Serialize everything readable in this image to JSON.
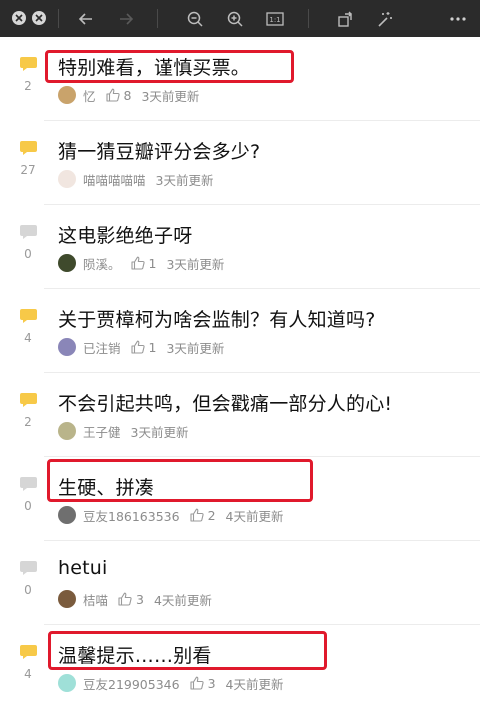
{
  "toolbar": {
    "icons": [
      "close-dot",
      "minimize-dot",
      "back-arrow-icon",
      "forward-arrow-icon",
      "zoom-out-icon",
      "zoom-in-icon",
      "actual-size-icon",
      "rotate-icon",
      "magic-wand-icon",
      "more-icon"
    ],
    "actual_size_label": "1:1"
  },
  "colors": {
    "bubble_active": "#f7c948",
    "bubble_inactive": "#d6d6d6",
    "highlight": "#e0192c"
  },
  "discussions": [
    {
      "title": "特别难看，谨慎买票。",
      "count": "2",
      "active": true,
      "author": "忆",
      "likes": "8",
      "time": "3天前更新",
      "highlighted": true
    },
    {
      "title": "猜一猜豆瓣评分会多少?",
      "count": "27",
      "active": true,
      "author": "喵喵喵喵喵",
      "likes": "",
      "time": "3天前更新",
      "highlighted": false
    },
    {
      "title": "这电影绝绝子呀",
      "count": "0",
      "active": false,
      "author": "陨溪。",
      "likes": "1",
      "time": "3天前更新",
      "highlighted": false
    },
    {
      "title": "关于贾樟柯为啥会监制？有人知道吗?",
      "count": "4",
      "active": true,
      "author": "已注销",
      "likes": "1",
      "time": "3天前更新",
      "highlighted": false
    },
    {
      "title": "不会引起共鸣，但会戳痛一部分人的心!",
      "count": "2",
      "active": true,
      "author": "王子健",
      "likes": "",
      "time": "3天前更新",
      "highlighted": false
    },
    {
      "title": "生硬、拼凑",
      "count": "0",
      "active": false,
      "author": "豆友186163536",
      "likes": "2",
      "time": "4天前更新",
      "highlighted": true
    },
    {
      "title": "hetui",
      "count": "0",
      "active": false,
      "author": "桔喵",
      "likes": "3",
      "time": "4天前更新",
      "highlighted": false
    },
    {
      "title": "温馨提示……别看",
      "count": "4",
      "active": true,
      "author": "豆友219905346",
      "likes": "3",
      "time": "4天前更新",
      "highlighted": true
    }
  ]
}
